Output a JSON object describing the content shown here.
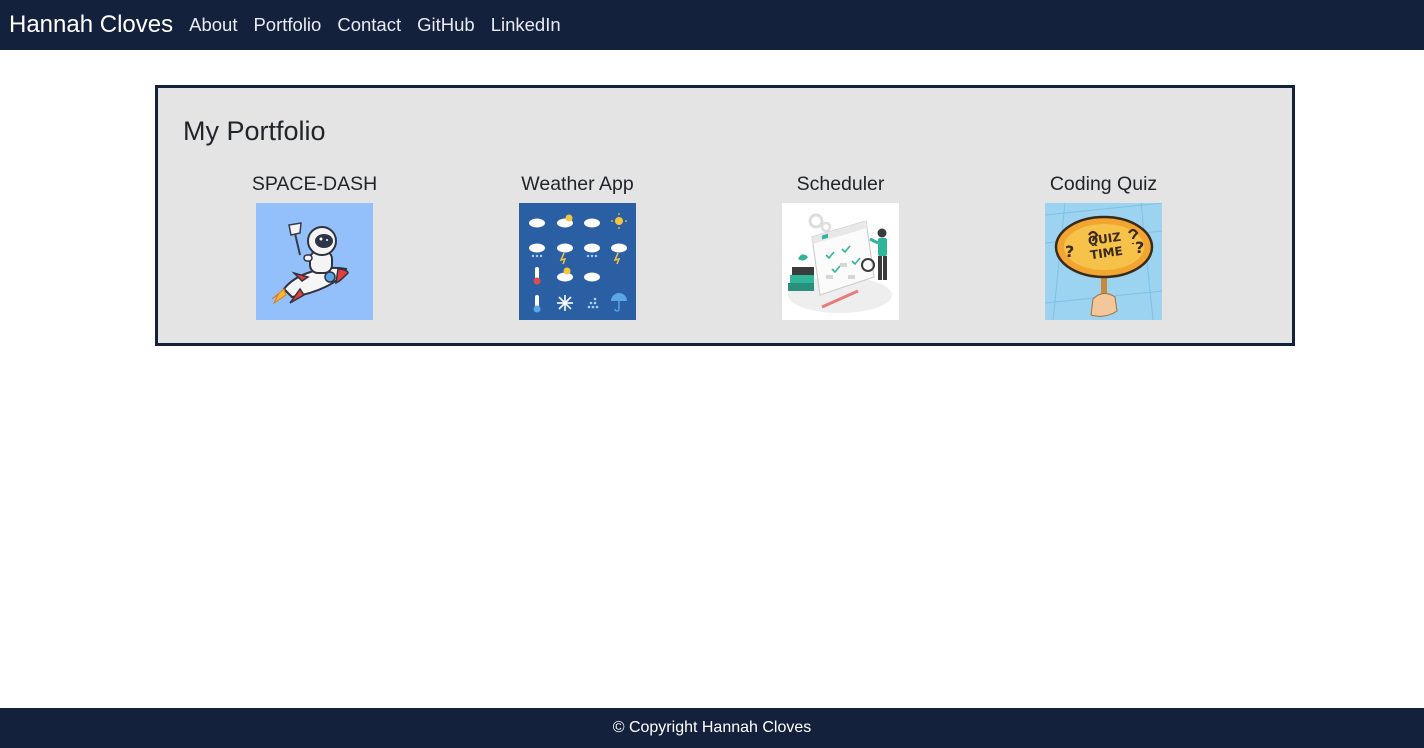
{
  "nav": {
    "brand": "Hannah Cloves",
    "links": [
      "About",
      "Portfolio",
      "Contact",
      "GitHub",
      "LinkedIn"
    ]
  },
  "portfolio": {
    "title": "My Portfolio",
    "projects": [
      {
        "title": "SPACE-DASH",
        "image": "astronaut-rocket-icon"
      },
      {
        "title": "Weather App",
        "image": "weather-icons-grid"
      },
      {
        "title": "Scheduler",
        "image": "calendar-person-illustration"
      },
      {
        "title": "Coding Quiz",
        "image": "quiz-time-sign"
      }
    ]
  },
  "footer": {
    "text": "© Copyright Hannah Cloves"
  },
  "colors": {
    "navbar": "#14213d",
    "panel_bg": "#e4e4e4",
    "panel_border": "#14213d"
  }
}
